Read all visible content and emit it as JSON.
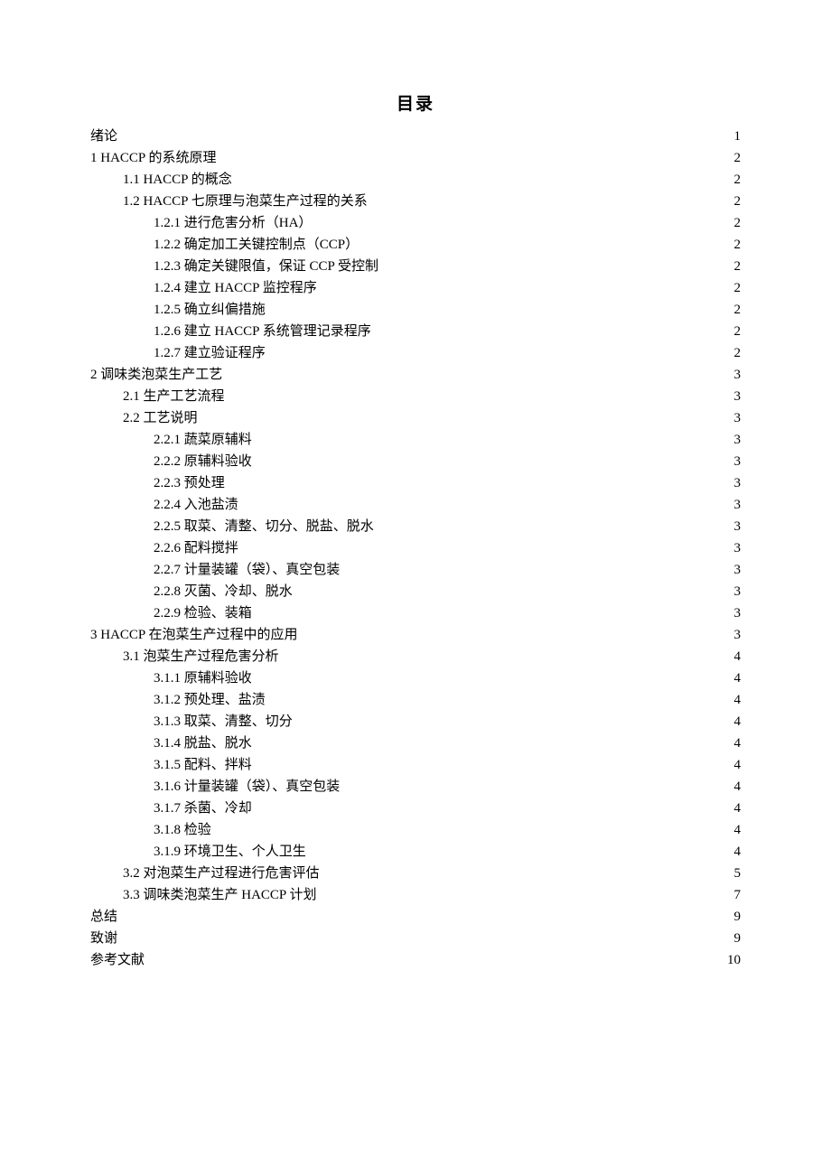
{
  "title": "目录",
  "entries": [
    {
      "level": 0,
      "label": "绪论",
      "page": "1"
    },
    {
      "level": 0,
      "label": "1 HACCP 的系统原理",
      "page": "2"
    },
    {
      "level": 1,
      "label": "1.1 HACCP 的概念",
      "page": "2"
    },
    {
      "level": 1,
      "label": "1.2 HACCP 七原理与泡菜生产过程的关系",
      "page": "2"
    },
    {
      "level": 2,
      "label": "1.2.1 进行危害分析（HA）",
      "page": "2"
    },
    {
      "level": 2,
      "label": "1.2.2 确定加工关键控制点（CCP）",
      "page": "2"
    },
    {
      "level": 2,
      "label": "1.2.3 确定关键限值，保证 CCP 受控制",
      "page": "2"
    },
    {
      "level": 2,
      "label": "1.2.4 建立 HACCP 监控程序",
      "page": "2"
    },
    {
      "level": 2,
      "label": "1.2.5 确立纠偏措施",
      "page": "2"
    },
    {
      "level": 2,
      "label": "1.2.6 建立 HACCP 系统管理记录程序",
      "page": "2"
    },
    {
      "level": 2,
      "label": "1.2.7 建立验证程序",
      "page": "2"
    },
    {
      "level": 0,
      "label": "2 调味类泡菜生产工艺",
      "page": "3"
    },
    {
      "level": 1,
      "label": "2.1 生产工艺流程",
      "page": "3"
    },
    {
      "level": 1,
      "label": "2.2 工艺说明",
      "page": "3"
    },
    {
      "level": 2,
      "label": "2.2.1 蔬菜原辅料",
      "page": "3"
    },
    {
      "level": 2,
      "label": "2.2.2 原辅料验收",
      "page": "3"
    },
    {
      "level": 2,
      "label": "2.2.3 预处理",
      "page": "3"
    },
    {
      "level": 2,
      "label": "2.2.4 入池盐渍",
      "page": "3"
    },
    {
      "level": 2,
      "label": "2.2.5 取菜、清整、切分、脱盐、脱水",
      "page": "3"
    },
    {
      "level": 2,
      "label": "2.2.6 配料搅拌",
      "page": "3"
    },
    {
      "level": 2,
      "label": "2.2.7 计量装罐（袋）、真空包装",
      "page": "3"
    },
    {
      "level": 2,
      "label": "2.2.8 灭菌、冷却、脱水",
      "page": "3"
    },
    {
      "level": 2,
      "label": "2.2.9 检验、装箱",
      "page": "3"
    },
    {
      "level": 0,
      "label": "3 HACCP 在泡菜生产过程中的应用",
      "page": "3"
    },
    {
      "level": 1,
      "label": "3.1 泡菜生产过程危害分析",
      "page": "4"
    },
    {
      "level": 2,
      "label": "3.1.1 原辅料验收",
      "page": "4"
    },
    {
      "level": 2,
      "label": "3.1.2 预处理、盐渍",
      "page": "4"
    },
    {
      "level": 2,
      "label": "3.1.3 取菜、清整、切分",
      "page": "4"
    },
    {
      "level": 2,
      "label": "3.1.4 脱盐、脱水",
      "page": "4"
    },
    {
      "level": 2,
      "label": "3.1.5 配料、拌料",
      "page": "4"
    },
    {
      "level": 2,
      "label": "3.1.6 计量装罐（袋）、真空包装",
      "page": "4"
    },
    {
      "level": 2,
      "label": "3.1.7 杀菌、冷却",
      "page": "4"
    },
    {
      "level": 2,
      "label": "3.1.8 检验",
      "page": "4"
    },
    {
      "level": 2,
      "label": "3.1.9 环境卫生、个人卫生",
      "page": "4"
    },
    {
      "level": 1,
      "label": "3.2 对泡菜生产过程进行危害评估",
      "page": "5"
    },
    {
      "level": 1,
      "label": "3.3 调味类泡菜生产 HACCP 计划",
      "page": "7"
    },
    {
      "level": 0,
      "label": "总结",
      "page": "9"
    },
    {
      "level": 0,
      "label": "致谢",
      "page": "9"
    },
    {
      "level": 0,
      "label": "参考文献",
      "page": "10"
    }
  ]
}
